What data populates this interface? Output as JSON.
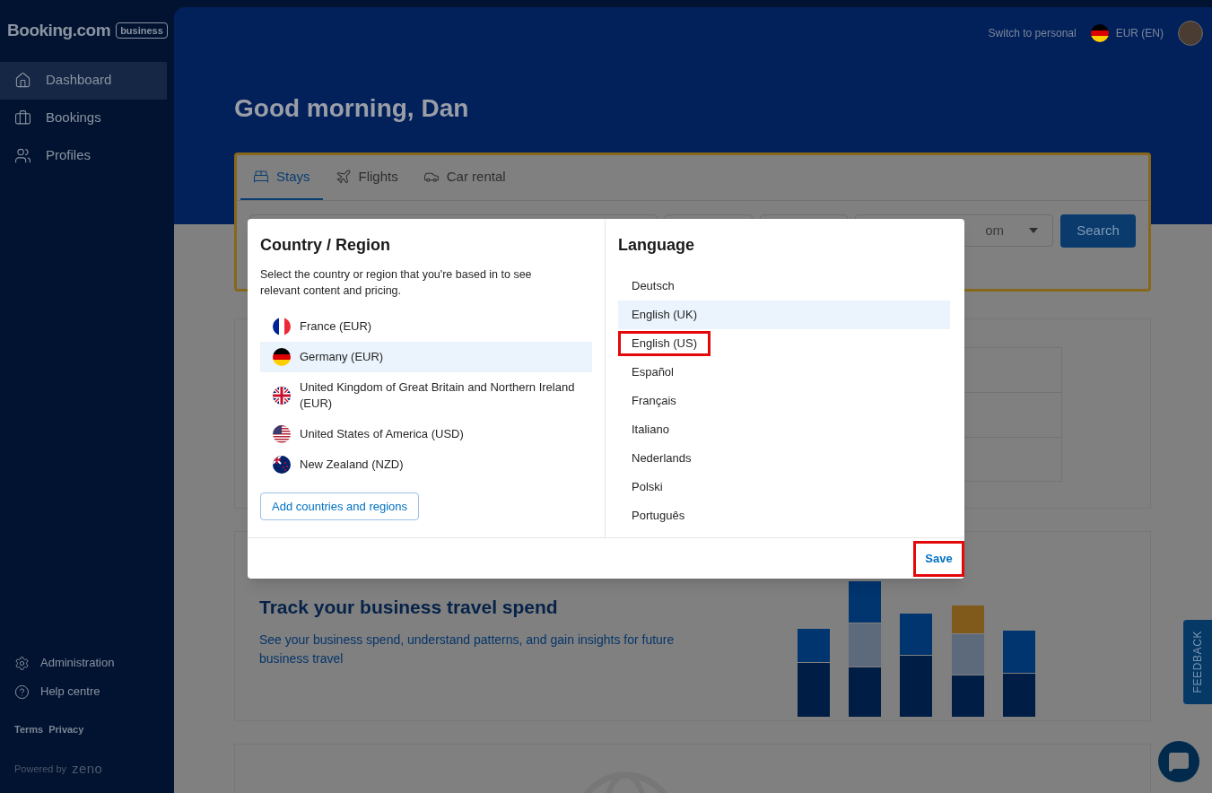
{
  "sidebar": {
    "logo": "Booking.com",
    "logo_badge": "business",
    "nav": [
      {
        "label": "Dashboard",
        "selected": true
      },
      {
        "label": "Bookings",
        "selected": false
      },
      {
        "label": "Profiles",
        "selected": false
      }
    ],
    "bottom": [
      "Administration",
      "Help centre"
    ],
    "links": [
      "Terms",
      "Privacy"
    ],
    "powered_by": "Powered by",
    "powered_brand": "zeno"
  },
  "topbar": {
    "switch": "Switch to personal",
    "currency": "EUR (EN)"
  },
  "greeting": "Good morning, Dan",
  "search": {
    "tabs": [
      {
        "label": "Stays",
        "selected": true
      },
      {
        "label": "Flights",
        "selected": false
      },
      {
        "label": "Car rental",
        "selected": false
      }
    ],
    "dropdown_value": "om",
    "button": "Search"
  },
  "spend_card": {
    "title": "Track your business travel spend",
    "text": "See your business spend, understand patterns, and gain insights for future business travel"
  },
  "feedback": "FEEDBACK",
  "modal": {
    "country_title": "Country / Region",
    "country_text": "Select the country or region that you're based in to see relevant content and pricing.",
    "countries": [
      {
        "kind": "fr",
        "label": "France (EUR)",
        "selected": false
      },
      {
        "kind": "de",
        "label": "Germany (EUR)",
        "selected": true
      },
      {
        "kind": "gb",
        "label": "United Kingdom of Great Britain and Northern Ireland (EUR)",
        "selected": false
      },
      {
        "kind": "us",
        "label": "United States of America (USD)",
        "selected": false
      },
      {
        "kind": "nz",
        "label": "New Zealand (NZD)",
        "selected": false
      }
    ],
    "add_button": "Add countries and regions",
    "language_title": "Language",
    "languages": [
      {
        "label": "Deutsch",
        "selected": false,
        "highlighted": false
      },
      {
        "label": "English (UK)",
        "selected": true,
        "highlighted": false
      },
      {
        "label": "English (US)",
        "selected": false,
        "highlighted": true
      },
      {
        "label": "Español",
        "selected": false,
        "highlighted": false
      },
      {
        "label": "Français",
        "selected": false,
        "highlighted": false
      },
      {
        "label": "Italiano",
        "selected": false,
        "highlighted": false
      },
      {
        "label": "Nederlands",
        "selected": false,
        "highlighted": false
      },
      {
        "label": "Polski",
        "selected": false,
        "highlighted": false
      },
      {
        "label": "Português",
        "selected": false,
        "highlighted": false
      }
    ],
    "save": {
      "label": "Save",
      "highlighted": true
    }
  }
}
